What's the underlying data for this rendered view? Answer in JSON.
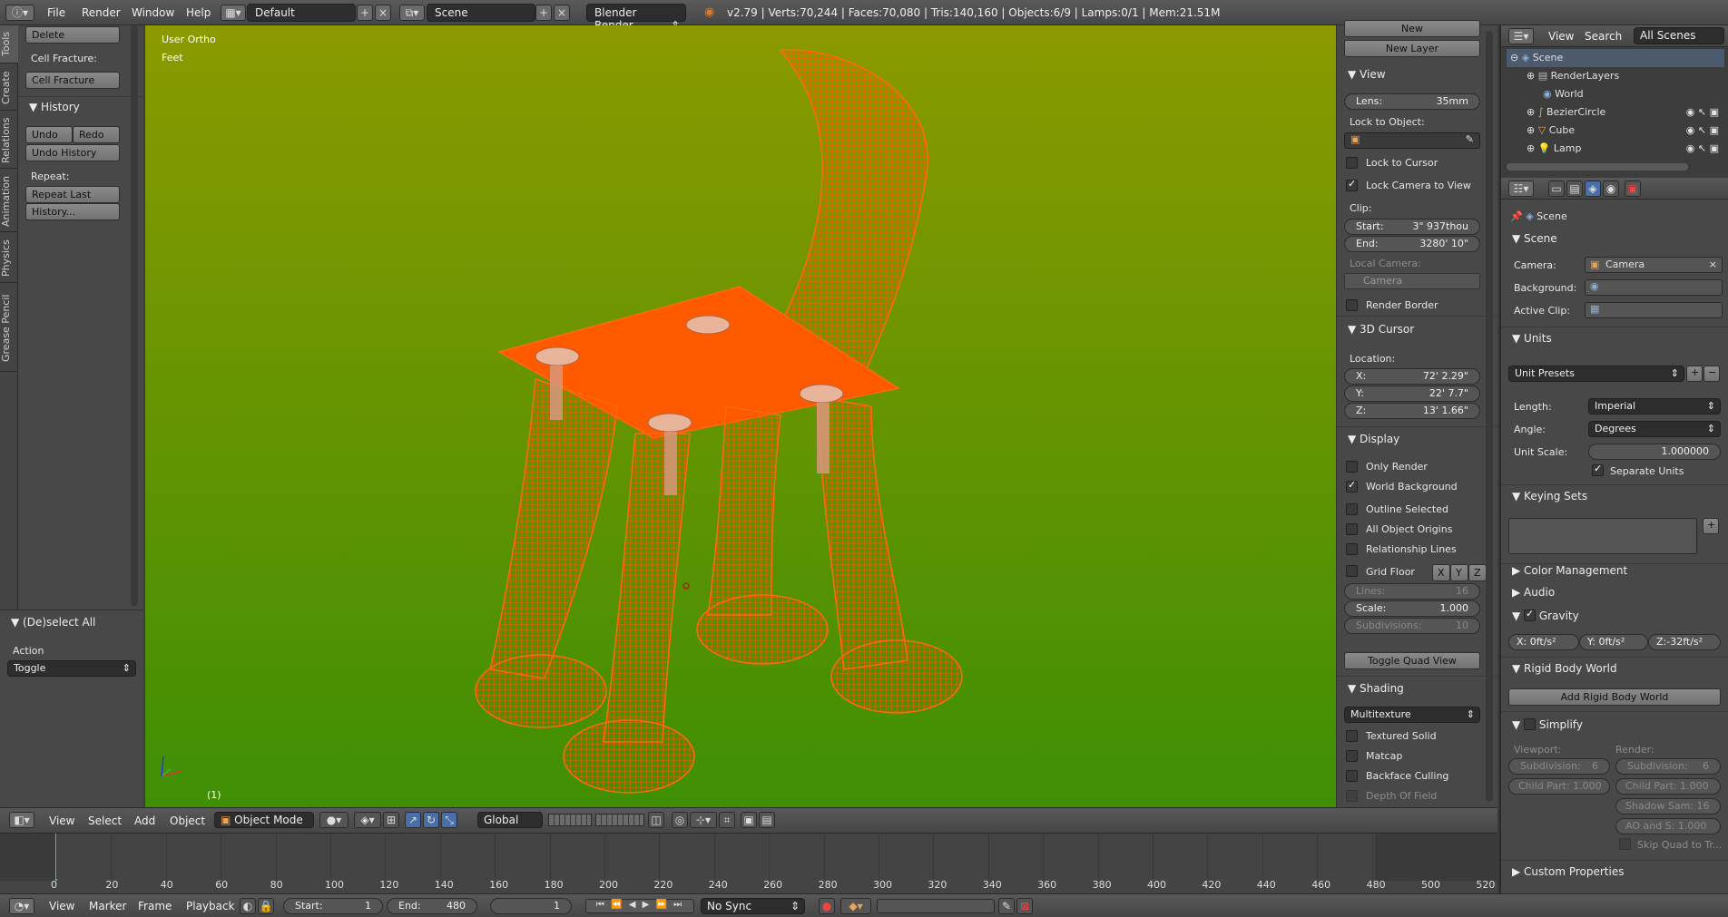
{
  "topbar": {
    "menus": [
      "File",
      "Render",
      "Window",
      "Help"
    ],
    "layout": "Default",
    "scene": "Scene",
    "engine": "Blender Render",
    "stats": "v2.79 | Verts:70,244 | Faces:70,080 | Tris:140,160 | Objects:6/9 | Lamps:0/1 | Mem:21.51M"
  },
  "tool_tabs": [
    "Tools",
    "Create",
    "Relations",
    "Animation",
    "Physics",
    "Grease Pencil"
  ],
  "toolshelf": {
    "delete": "Delete",
    "cell_fracture_label": "Cell Fracture:",
    "cell_fracture_btn": "Cell Fracture",
    "history_header": "History",
    "undo": "Undo",
    "redo": "Redo",
    "undo_history": "Undo History",
    "repeat_label": "Repeat:",
    "repeat_last": "Repeat Last",
    "history_btn": "History..."
  },
  "operator": {
    "header": "(De)select All",
    "action_label": "Action",
    "action_value": "Toggle"
  },
  "viewport": {
    "view_name": "User Ortho",
    "units": "Feet",
    "frame": "(1)"
  },
  "npanel": {
    "new": "New",
    "new_layer": "New Layer",
    "view_header": "View",
    "lens_label": "Lens:",
    "lens_value": "35mm",
    "lock_to_object": "Lock to Object:",
    "lock_to_cursor": "Lock to Cursor",
    "lock_camera": "Lock Camera to View",
    "clip_label": "Clip:",
    "clip_start_label": "Start:",
    "clip_start": "3\" 937thou",
    "clip_end_label": "End:",
    "clip_end": "3280' 10\"",
    "local_camera": "Local Camera:",
    "camera_placeholder": "Camera",
    "render_border": "Render Border",
    "cursor_header": "3D Cursor",
    "location": "Location:",
    "x_label": "X:",
    "x": "72' 2.29\"",
    "y_label": "Y:",
    "y": "22' 7.7\"",
    "z_label": "Z:",
    "z": "13' 1.66\"",
    "display_header": "Display",
    "only_render": "Only Render",
    "world_background": "World Background",
    "outline_selected": "Outline Selected",
    "all_origins": "All Object Origins",
    "relationship_lines": "Relationship Lines",
    "grid_floor": "Grid Floor",
    "axes": [
      "X",
      "Y",
      "Z"
    ],
    "lines_label": "Lines:",
    "lines": "16",
    "scale_label": "Scale:",
    "scale": "1.000",
    "subdiv_label": "Subdivisions:",
    "subdiv": "10",
    "toggle_quad": "Toggle Quad View",
    "shading_header": "Shading",
    "shading_mode": "Multitexture",
    "textured_solid": "Textured Solid",
    "matcap": "Matcap",
    "backface": "Backface Culling",
    "dof": "Depth Of Field"
  },
  "vpheader": {
    "view": "View",
    "select": "Select",
    "add": "Add",
    "object": "Object",
    "mode": "Object Mode",
    "orientation": "Global"
  },
  "timeline": {
    "ticks": [
      "0",
      "20",
      "40",
      "60",
      "80",
      "100",
      "120",
      "140",
      "160",
      "180",
      "200",
      "220",
      "240",
      "260",
      "280",
      "300",
      "320",
      "340",
      "360",
      "380",
      "400",
      "420",
      "440",
      "460",
      "480",
      "500",
      "520"
    ]
  },
  "tlheader": {
    "view": "View",
    "marker": "Marker",
    "frame": "Frame",
    "playback": "Playback",
    "start_label": "Start:",
    "start": "1",
    "end_label": "End:",
    "end": "480",
    "current": "1",
    "sync": "No Sync"
  },
  "outliner": {
    "view": "View",
    "search": "Search",
    "scope": "All Scenes",
    "items": [
      "Scene",
      "RenderLayers",
      "World",
      "BezierCircle",
      "Cube",
      "Lamp"
    ]
  },
  "props": {
    "breadcrumb": "Scene",
    "scene_header": "Scene",
    "camera_label": "Camera:",
    "camera_value": "Camera",
    "background_label": "Background:",
    "active_clip_label": "Active Clip:",
    "units_header": "Units",
    "unit_presets": "Unit Presets",
    "length_label": "Length:",
    "length_value": "Imperial",
    "angle_label": "Angle:",
    "angle_value": "Degrees",
    "unit_scale_label": "Unit Scale:",
    "unit_scale": "1.000000",
    "separate_units": "Separate Units",
    "keying_header": "Keying Sets",
    "color_mgmt": "Color Management",
    "audio": "Audio",
    "gravity": "Gravity",
    "gx": "X:   0ft/s²",
    "gy": "Y:   0ft/s²",
    "gz": "Z:-32ft/s²",
    "rigid_header": "Rigid Body World",
    "add_rigid": "Add Rigid Body World",
    "simplify": "Simplify",
    "viewport_label": "Viewport:",
    "render_label": "Render:",
    "subdiv_v": "Subdivision:",
    "subdiv_v_val": "6",
    "subdiv_r": "Subdivision:",
    "subdiv_r_val": "6",
    "child_v": "Child Part: 1.000",
    "child_r": "Child Part: 1.000",
    "shadow": "Shadow Sam: 16",
    "ao": "AO and S:  1.000",
    "skip_quad": "Skip Quad to Tr...",
    "custom_props": "Custom Properties"
  }
}
